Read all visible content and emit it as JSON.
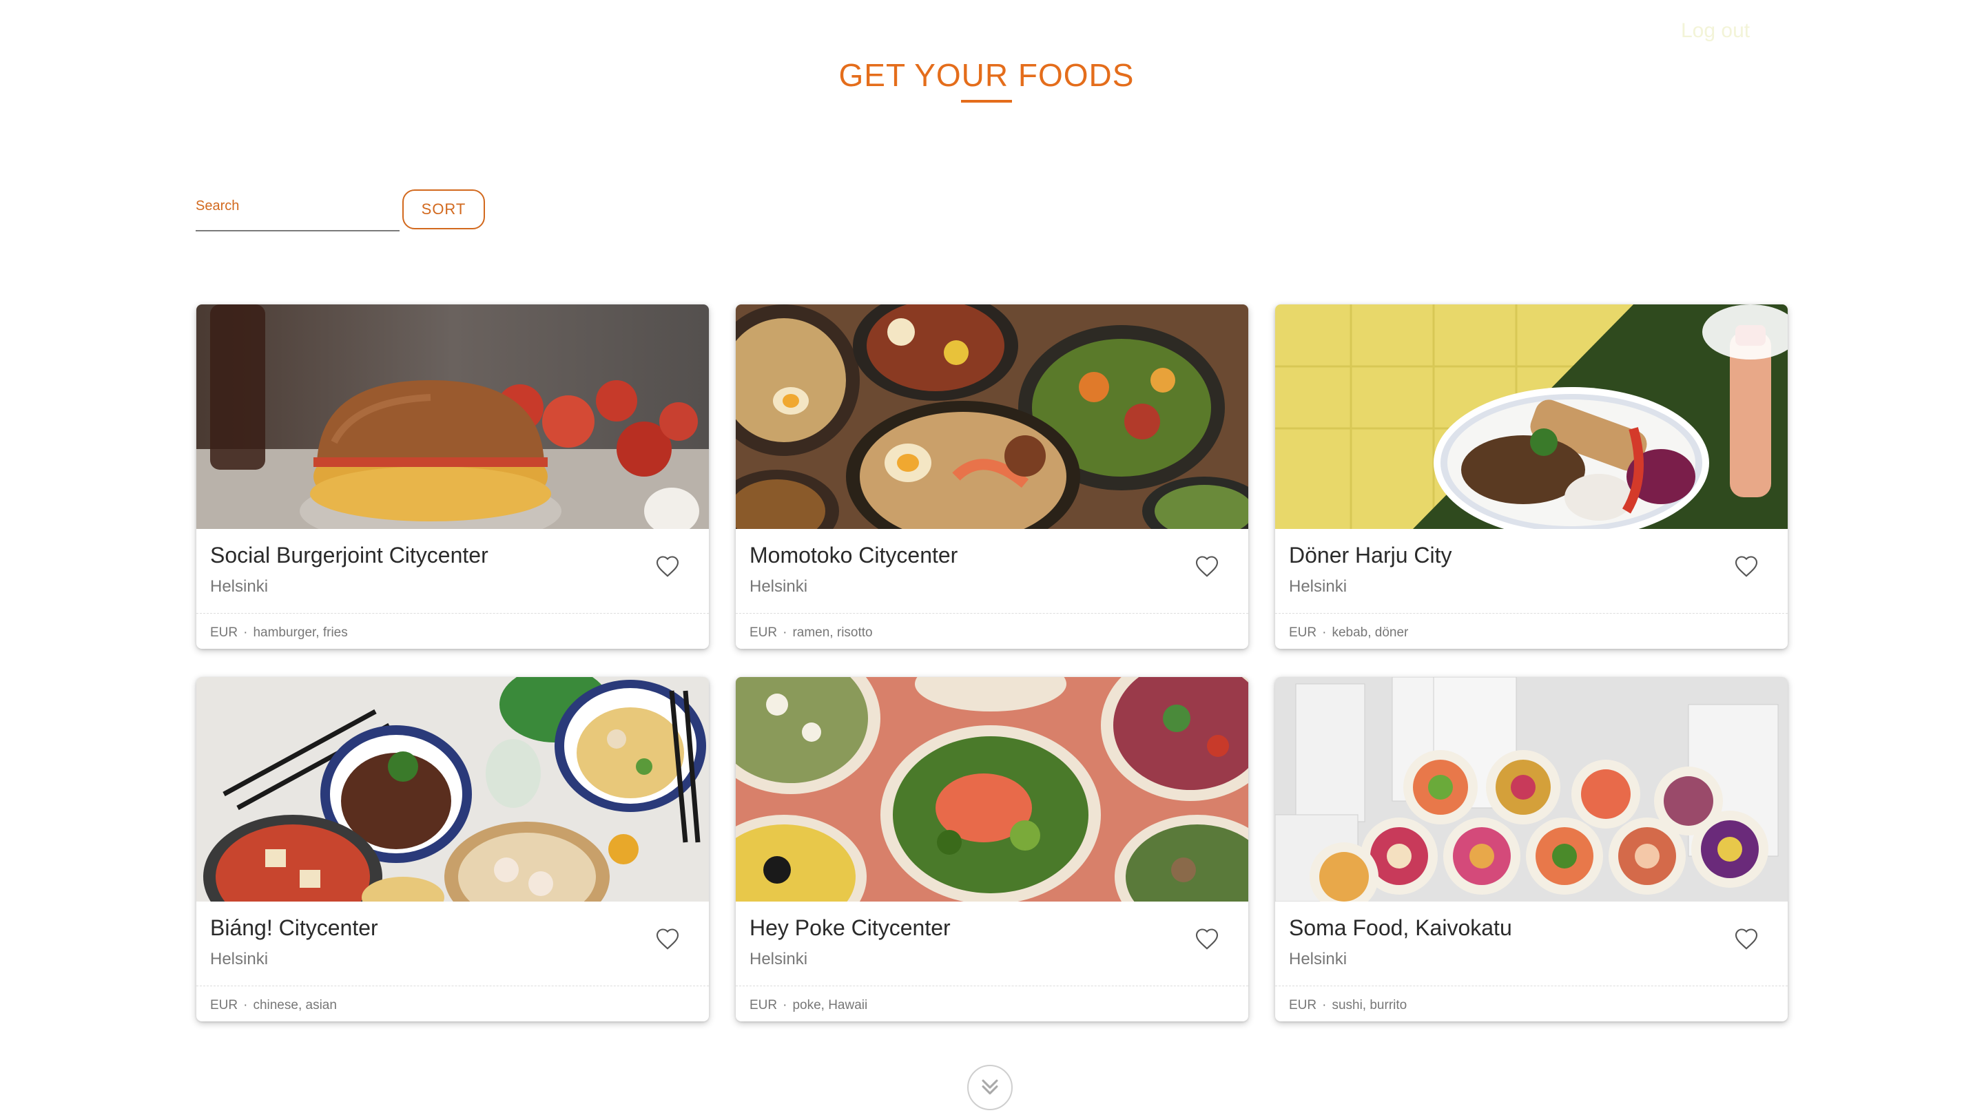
{
  "header": {
    "logout_label": "Log out",
    "title": "GET YOUR FOODS"
  },
  "controls": {
    "search_label": "Search",
    "search_value": "",
    "sort_label": "SORT"
  },
  "colors": {
    "accent": "#e46d1b",
    "text_primary": "#2a2a2a",
    "text_secondary": "#777777"
  },
  "restaurants": [
    {
      "name": "Social Burgerjoint Citycenter",
      "city": "Helsinki",
      "currency": "EUR",
      "tags": "hamburger, fries",
      "image": "burger-photo"
    },
    {
      "name": "Momotoko Citycenter",
      "city": "Helsinki",
      "currency": "EUR",
      "tags": "ramen, risotto",
      "image": "ramen-bowls-photo"
    },
    {
      "name": "Döner Harju City",
      "city": "Helsinki",
      "currency": "EUR",
      "tags": "kebab, döner",
      "image": "kebab-plate-photo"
    },
    {
      "name": "Biáng! Citycenter",
      "city": "Helsinki",
      "currency": "EUR",
      "tags": "chinese, asian",
      "image": "chinese-dishes-photo"
    },
    {
      "name": "Hey Poke Citycenter",
      "city": "Helsinki",
      "currency": "EUR",
      "tags": "poke, Hawaii",
      "image": "poke-bowls-photo"
    },
    {
      "name": "Soma Food, Kaivokatu",
      "city": "Helsinki",
      "currency": "EUR",
      "tags": "sushi, burrito",
      "image": "sushi-burrito-photo"
    }
  ],
  "icons": {
    "favorite": "heart-outline-icon",
    "scroll": "double-chevron-down-icon"
  }
}
